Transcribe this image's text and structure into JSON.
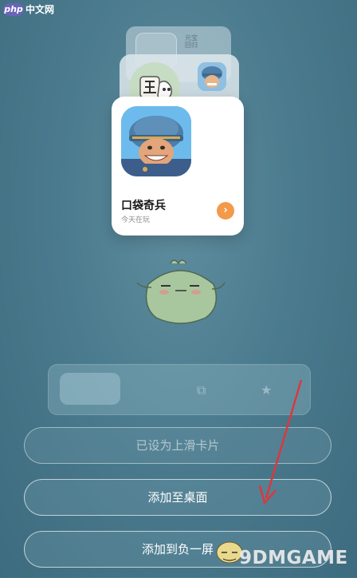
{
  "watermark": {
    "badge": "php",
    "site": "中文网"
  },
  "cards": {
    "back_small_text": [
      "元宝",
      "回归"
    ],
    "main": {
      "title": "口袋奇兵",
      "subtitle": "今天在玩",
      "go_icon": "chevron-right-icon"
    }
  },
  "buttons": {
    "set_swipe_card": "已设为上滑卡片",
    "add_to_desktop": "添加至桌面",
    "add_to_minus_one": "添加到负一屏"
  },
  "bottom_watermark": "9DMGAME",
  "colors": {
    "background": "#4b7b8e",
    "card": "#ffffff",
    "go_button": "#f39a4a",
    "arrow": "#d8393f"
  }
}
